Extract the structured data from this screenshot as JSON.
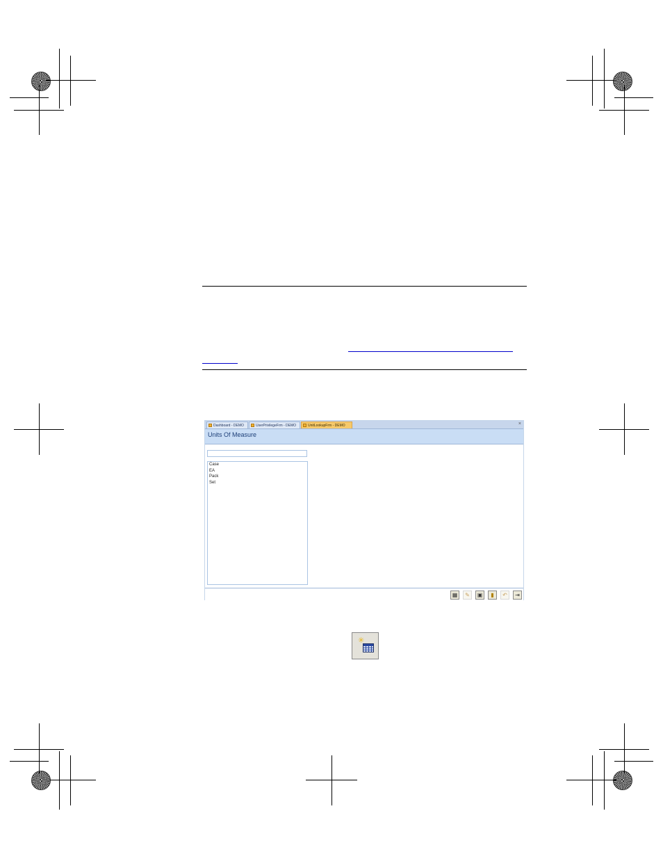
{
  "app": {
    "tabs": [
      {
        "label": "Dashboard - DEMO",
        "active": false
      },
      {
        "label": "UserPrivilegeFrm - DEMO",
        "active": false
      },
      {
        "label": "UnitLookupFrm - DEMO",
        "active": true
      }
    ],
    "close_glyph": "×",
    "header_title": "Units Of Measure",
    "search": {
      "value": "",
      "placeholder": ""
    },
    "list_items": [
      "Case",
      "EA",
      "Pack",
      "Set"
    ],
    "toolbar": [
      {
        "icon": "new-record-icon",
        "enabled": true
      },
      {
        "icon": "edit-record-icon",
        "enabled": false
      },
      {
        "icon": "save-record-icon",
        "enabled": true
      },
      {
        "icon": "delete-record-icon",
        "enabled": true
      },
      {
        "icon": "undo-icon",
        "enabled": false
      },
      {
        "icon": "exit-icon",
        "enabled": true
      }
    ]
  },
  "big_button": {
    "icon": "new-record-icon"
  },
  "colors": {
    "tab_active": "#f6c96a",
    "header_bg": "#c9ddf5",
    "header_text": "#1d3f78",
    "border": "#a9c3e3"
  }
}
